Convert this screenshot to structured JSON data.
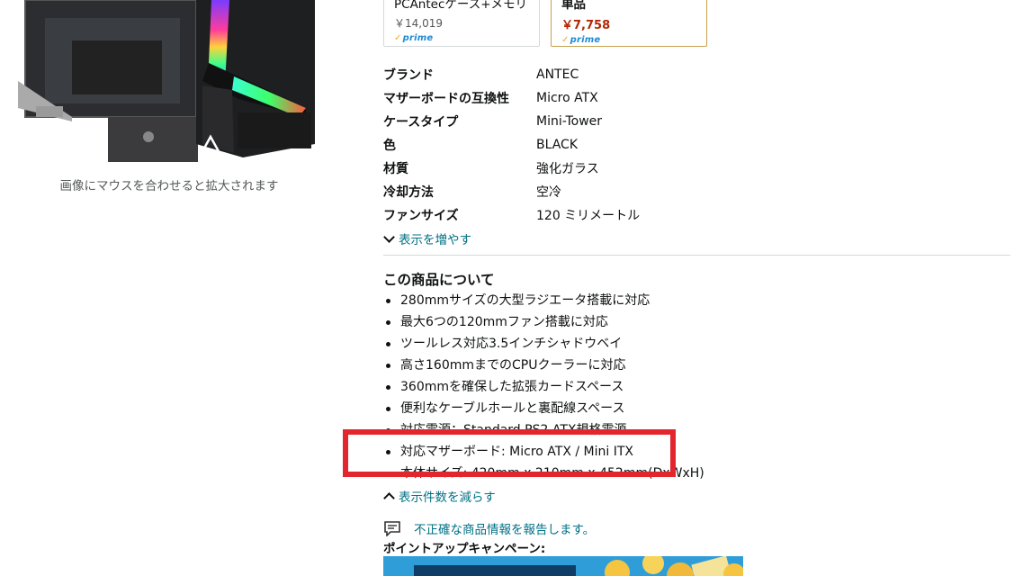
{
  "image_caption": "画像にマウスを合わせると拡大されます",
  "options": [
    {
      "name": "PCAntecケース+メモリ",
      "price": "￥14,019",
      "badge": "prime"
    },
    {
      "name": "単品",
      "price": "￥7,758",
      "badge": "prime"
    }
  ],
  "specs": [
    {
      "key": "ブランド",
      "value": "ANTEC"
    },
    {
      "key": "マザーボードの互換性",
      "value": "Micro ATX"
    },
    {
      "key": "ケースタイプ",
      "value": "Mini-Tower"
    },
    {
      "key": "色",
      "value": "BLACK"
    },
    {
      "key": "材質",
      "value": "強化ガラス"
    },
    {
      "key": "冷却方法",
      "value": "空冷"
    },
    {
      "key": "ファンサイズ",
      "value": "120 ミリメートル"
    }
  ],
  "show_more_label": "表示を増やす",
  "about": {
    "title": "この商品について",
    "bullets": [
      "280mmサイズの大型ラジエータ搭載に対応",
      "最大6つの120mmファン搭載に対応",
      "ツールレス対応3.5インチシャドウベイ",
      "高さ160mmまでのCPUクーラーに対応",
      "360mmを確保した拡張カードスペース",
      "便利なケーブルホールと裏配線スペース",
      "対応電源：Standard PS2 ATX規格電源",
      "対応マザーボード: Micro ATX / Mini ITX",
      "本体サイズ: 420mm x 210mm x 452mm(DxWxH)"
    ]
  },
  "show_less_label": "表示件数を減らす",
  "report_label": "不正確な商品情報を報告します。",
  "point_up_label": "ポイントアップキャンペーン:",
  "colors": {
    "link": "#007185",
    "highlight": "#e3262d",
    "price": "#b12704",
    "prime": "#1f8bd1",
    "selected_border": "#c7a14f"
  },
  "icons": [
    "chevron-down-icon",
    "chevron-up-icon",
    "report-icon",
    "prime-check-icon"
  ]
}
